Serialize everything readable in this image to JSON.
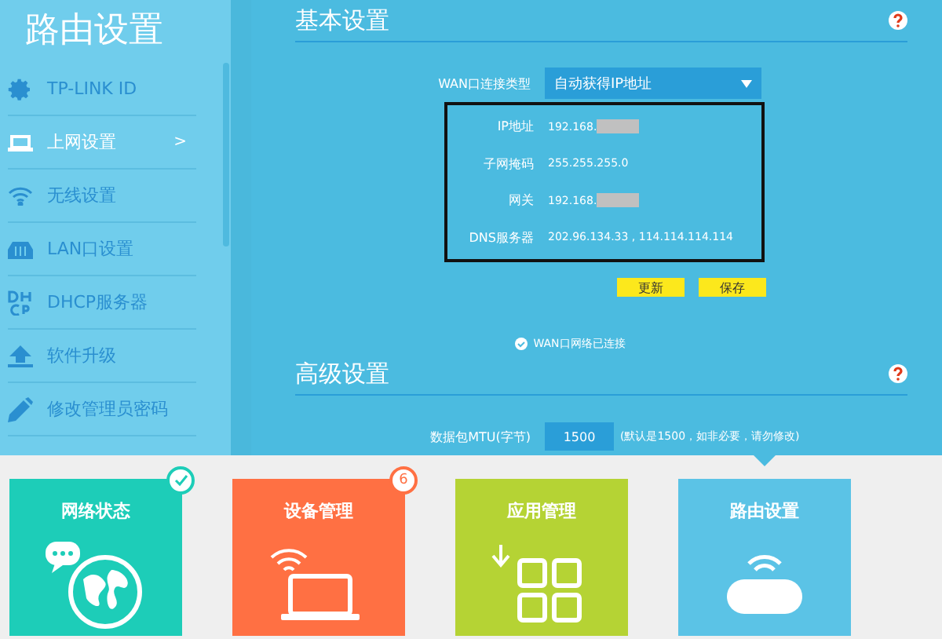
{
  "sidebar": {
    "title": "路由设置",
    "items": [
      {
        "label": "TP-LINK ID",
        "selected": false
      },
      {
        "label": "上网设置",
        "selected": true,
        "arrow": ">"
      },
      {
        "label": "无线设置",
        "selected": false
      },
      {
        "label": "LAN口设置",
        "selected": false
      },
      {
        "label": "DHCP服务器",
        "selected": false
      },
      {
        "label": "软件升级",
        "selected": false
      },
      {
        "label": "修改管理员密码",
        "selected": false
      }
    ]
  },
  "basic": {
    "title": "基本设置",
    "wan_type": {
      "label": "WAN口连接类型",
      "value": "自动获得IP地址"
    },
    "fields": [
      {
        "label": "IP地址",
        "value": "192.168.",
        "redacted": true
      },
      {
        "label": "子网掩码",
        "value": "255.255.255.0",
        "redacted": false
      },
      {
        "label": "网关",
        "value": "192.168.",
        "redacted": true
      },
      {
        "label": "DNS服务器",
        "value": "202.96.134.33 , 114.114.114.114",
        "redacted": false
      }
    ],
    "buttons": [
      "更新",
      "保存"
    ],
    "status": "WAN口网络已连接"
  },
  "advanced": {
    "title": "高级设置",
    "mtu": {
      "label": "数据包MTU(字节)",
      "value": "1500",
      "hint": "(默认是1500，如非必要，请勿修改)"
    }
  },
  "tiles": [
    {
      "label": "网络状态",
      "color": "#1dcdb8",
      "selected": false,
      "checked": true
    },
    {
      "label": "设备管理",
      "color": "#ff7043",
      "selected": false,
      "checked": false,
      "badge": "6"
    },
    {
      "label": "应用管理",
      "color": "#b5d334",
      "selected": false,
      "checked": false
    },
    {
      "label": "路由设置",
      "color": "#5bc3e6",
      "selected": true,
      "checked": false
    }
  ]
}
